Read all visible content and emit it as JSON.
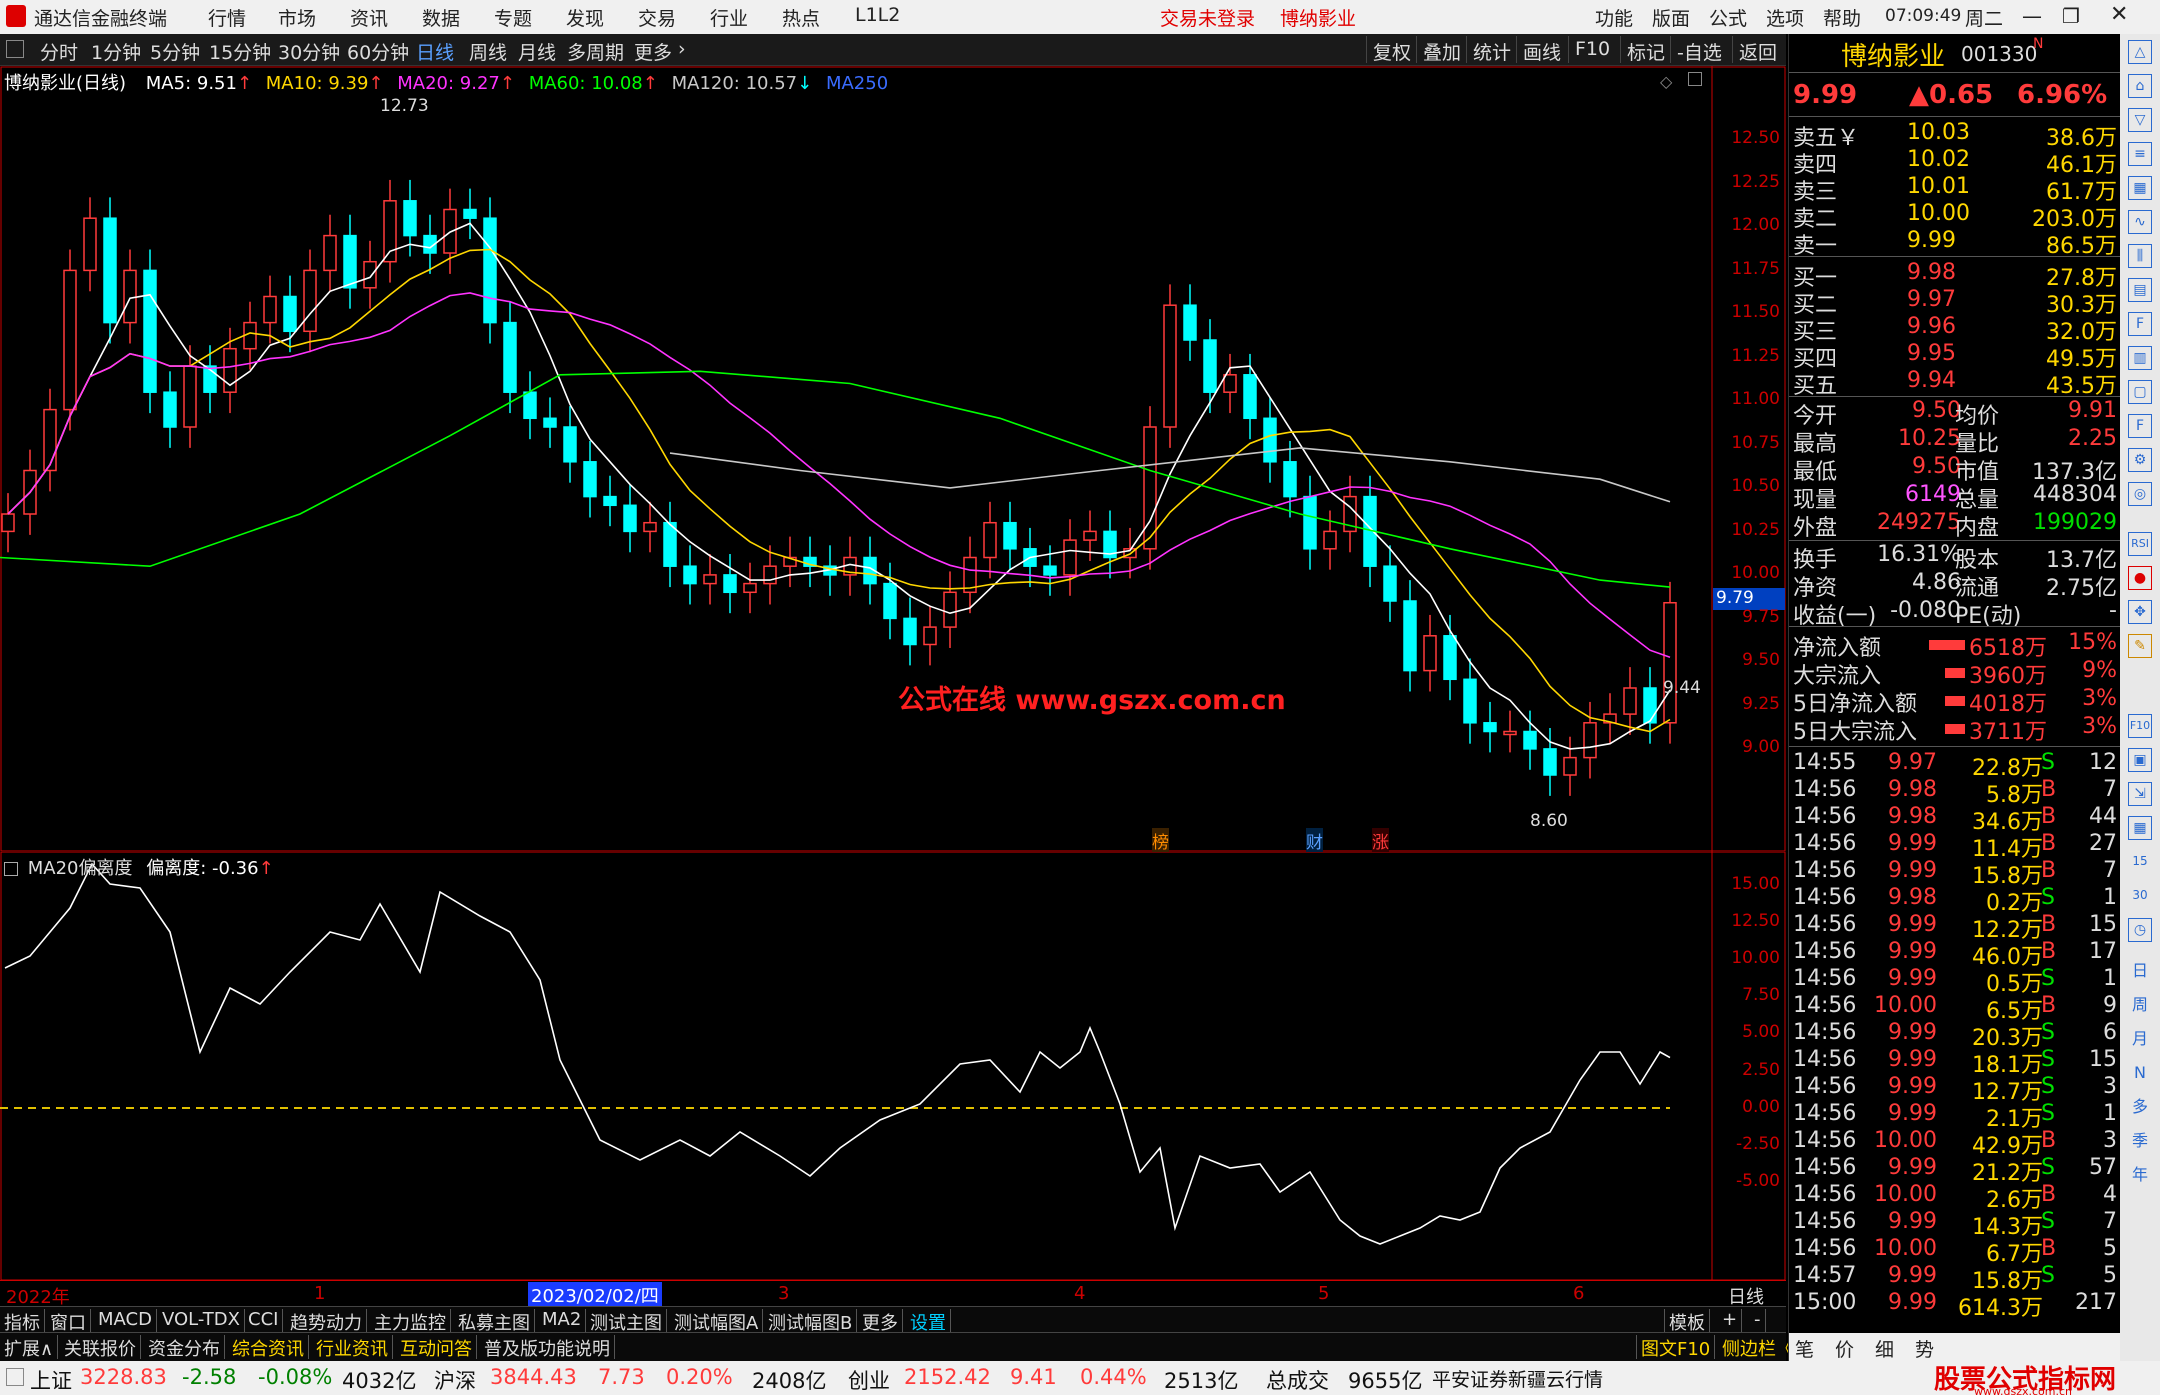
{
  "titlebar": {
    "app_title": "通达信金融终端",
    "menus": [
      "行情",
      "市场",
      "资讯",
      "数据",
      "专题",
      "发现",
      "交易",
      "行业",
      "热点",
      "L1L2"
    ],
    "trade_status": "交易未登录",
    "stock_name": "博纳影业",
    "right_menus": [
      "功能",
      "版面",
      "公式",
      "选项",
      "帮助"
    ],
    "time": "07:09:49",
    "weekday": "周二"
  },
  "toolbar": {
    "periods": [
      "分时",
      "1分钟",
      "5分钟",
      "15分钟",
      "30分钟",
      "60分钟",
      "日线",
      "周线",
      "月线",
      "多周期",
      "更多"
    ],
    "active": "日线",
    "right_buttons": [
      "复权",
      "叠加",
      "统计",
      "画线",
      "F10",
      "标记",
      "-自选",
      "返回"
    ]
  },
  "kline": {
    "title": "博纳影业(日线)",
    "ma": [
      {
        "label": "MA5: 9.51",
        "color": "#ffffff"
      },
      {
        "label": "MA10: 9.39",
        "color": "#ffd700"
      },
      {
        "label": "MA20: 9.27",
        "color": "#ff33ff"
      },
      {
        "label": "MA60: 10.08",
        "color": "#00ff00"
      },
      {
        "label": "MA120: 10.57",
        "color": "#c8c8c8"
      },
      {
        "label": "MA250",
        "color": "#3a6cff"
      }
    ],
    "high_label": "12.73",
    "low_label": "8.60",
    "cur_label": "9.44",
    "price_tag": "9.79",
    "watermark": "公式在线  www.gszx.com.cn",
    "markers": [
      "榜",
      "财",
      "涨"
    ],
    "axis": [
      "12.50",
      "12.25",
      "12.00",
      "11.75",
      "11.50",
      "11.25",
      "11.00",
      "10.75",
      "10.50",
      "10.25",
      "10.00",
      "9.75",
      "9.50",
      "9.25",
      "9.00"
    ]
  },
  "indicator": {
    "title": "MA20偏离度",
    "value_label": "偏离度: -0.36",
    "axis": [
      "15.00",
      "12.50",
      "10.00",
      "7.50",
      "5.00",
      "2.50",
      "0.00",
      "-2.50",
      "-5.00"
    ]
  },
  "dates": {
    "labels": [
      "2022年",
      "1",
      "2023/02/02/四",
      "3",
      "4",
      "5",
      "6"
    ],
    "period": "日线"
  },
  "tabs1": [
    "指标",
    "窗口",
    "MACD",
    "VOL-TDX",
    "CCI",
    "趋势动力",
    "主力监控",
    "私募主图",
    "MA2",
    "测试主图",
    "测试幅图A",
    "测试幅图B",
    "更多",
    "设置"
  ],
  "tabs1_right": [
    "模板",
    "+",
    "-"
  ],
  "tabs2": [
    "扩展∧",
    "关联报价",
    "资金分布",
    "综合资讯",
    "行业资讯",
    "互动问答",
    "普及版功能说明"
  ],
  "tabs2_right": [
    "图文F10",
    "侧边栏《"
  ],
  "quote": {
    "name": "博纳影业",
    "code": "001330",
    "price": "9.99",
    "change": "▲0.65",
    "pct": "6.96%",
    "sells": [
      [
        "卖五￥",
        "10.03",
        "38.6万"
      ],
      [
        "卖四",
        "10.02",
        "46.1万"
      ],
      [
        "卖三",
        "10.01",
        "61.7万"
      ],
      [
        "卖二",
        "10.00",
        "203.0万"
      ],
      [
        "卖一",
        "9.99",
        "86.5万"
      ]
    ],
    "buys": [
      [
        "买一",
        "9.98",
        "27.8万"
      ],
      [
        "买二",
        "9.97",
        "30.3万"
      ],
      [
        "买三",
        "9.96",
        "32.0万"
      ],
      [
        "买四",
        "9.95",
        "49.5万"
      ],
      [
        "买五",
        "9.94",
        "43.5万"
      ]
    ],
    "stats": [
      [
        "今开",
        "9.50",
        "均价",
        "9.91"
      ],
      [
        "最高",
        "10.25",
        "量比",
        "2.25"
      ],
      [
        "最低",
        "9.50",
        "市值",
        "137.3亿"
      ],
      [
        "现量",
        "6149",
        "总量",
        "448304"
      ],
      [
        "外盘",
        "249275",
        "内盘",
        "199029"
      ]
    ],
    "stats2": [
      [
        "换手",
        "16.31%",
        "股本",
        "13.7亿"
      ],
      [
        "净资",
        "4.86",
        "流通",
        "2.75亿"
      ],
      [
        "收益(一)",
        "-0.080",
        "PE(动)",
        "-"
      ]
    ],
    "flows": [
      [
        "净流入额",
        "6518万",
        "15%"
      ],
      [
        "大宗流入",
        "3960万",
        "9%"
      ],
      [
        "5日净流入额",
        "4018万",
        "3%"
      ],
      [
        "5日大宗流入",
        "3711万",
        "3%"
      ]
    ],
    "ticks": [
      [
        "14:55",
        "9.97",
        "22.8万",
        "S",
        "12"
      ],
      [
        "14:56",
        "9.98",
        "5.8万",
        "B",
        "7"
      ],
      [
        "14:56",
        "9.98",
        "34.6万",
        "B",
        "44"
      ],
      [
        "14:56",
        "9.99",
        "11.4万",
        "B",
        "27"
      ],
      [
        "14:56",
        "9.99",
        "15.8万",
        "B",
        "7"
      ],
      [
        "14:56",
        "9.98",
        "0.2万",
        "S",
        "1"
      ],
      [
        "14:56",
        "9.99",
        "12.2万",
        "B",
        "15"
      ],
      [
        "14:56",
        "9.99",
        "46.0万",
        "B",
        "17"
      ],
      [
        "14:56",
        "9.99",
        "0.5万",
        "S",
        "1"
      ],
      [
        "14:56",
        "10.00",
        "6.5万",
        "B",
        "9"
      ],
      [
        "14:56",
        "9.99",
        "20.3万",
        "S",
        "6"
      ],
      [
        "14:56",
        "9.99",
        "18.1万",
        "S",
        "15"
      ],
      [
        "14:56",
        "9.99",
        "12.7万",
        "S",
        "3"
      ],
      [
        "14:56",
        "9.99",
        "2.1万",
        "S",
        "1"
      ],
      [
        "14:56",
        "10.00",
        "42.9万",
        "B",
        "3"
      ],
      [
        "14:56",
        "9.99",
        "21.2万",
        "S",
        "57"
      ],
      [
        "14:56",
        "10.00",
        "2.6万",
        "B",
        "4"
      ],
      [
        "14:56",
        "9.99",
        "14.3万",
        "S",
        "7"
      ],
      [
        "14:56",
        "10.00",
        "6.7万",
        "B",
        "5"
      ],
      [
        "14:57",
        "9.99",
        "15.8万",
        "S",
        "5"
      ],
      [
        "15:00",
        "9.99",
        "614.3万",
        "",
        "217"
      ]
    ],
    "bottom_tabs": [
      "笔",
      "价",
      "细",
      "势"
    ]
  },
  "side_icons": [
    "日",
    "周",
    "月",
    "N",
    "多",
    "季",
    "年",
    "15",
    "30",
    "RSI",
    "F10"
  ],
  "status": {
    "items": [
      [
        "上证",
        "3228.83",
        "-2.58",
        "-0.08%",
        "4032亿"
      ],
      [
        "沪深",
        "3844.43",
        "7.73",
        "0.20%",
        "2408亿"
      ],
      [
        "创业",
        "2152.42",
        "9.41",
        "0.44%",
        "2513亿"
      ]
    ],
    "total_label": "总成交",
    "total": "9655亿",
    "broker": "平安证券新疆云行情",
    "logo": "股票公式指标网",
    "logo_url": "www.gszx.com.cn"
  },
  "colors": {
    "up": "#ff3b3b",
    "down": "#00ffff",
    "ma5": "#ffffff",
    "ma10": "#ffd700",
    "ma20": "#ff33ff",
    "ma60": "#00ff00",
    "ma120": "#c8c8c8"
  }
}
